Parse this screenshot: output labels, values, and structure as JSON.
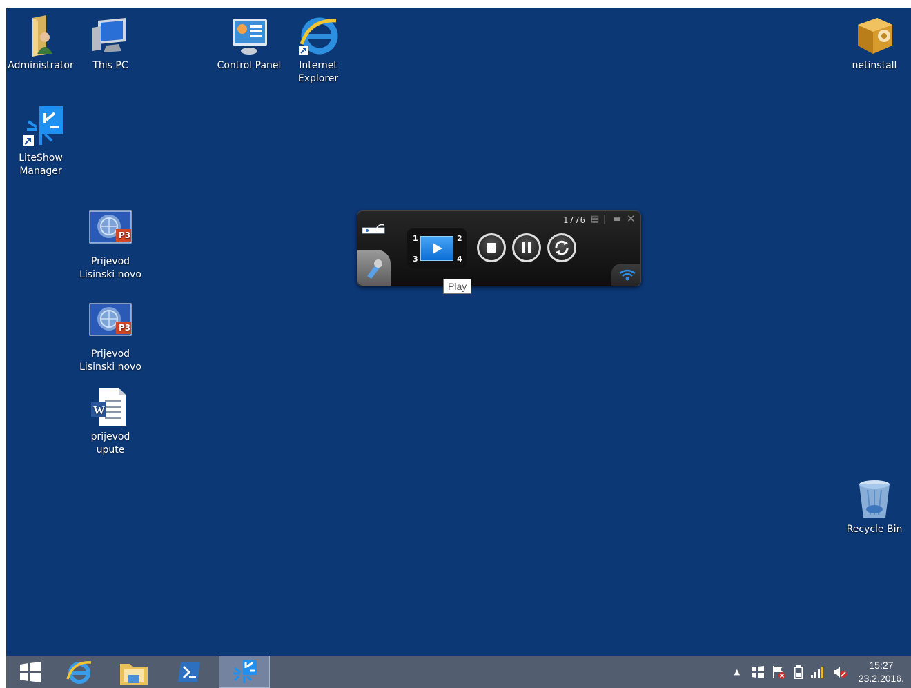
{
  "desktop": {
    "background_color": "#0c3876",
    "icons": [
      {
        "label": "Administrator",
        "icon": "user-folder-icon"
      },
      {
        "label": "This PC",
        "icon": "computer-icon"
      },
      {
        "label": "Control Panel",
        "icon": "control-panel-icon"
      },
      {
        "label": "Internet\nExplorer",
        "icon": "internet-explorer-icon"
      },
      {
        "label": "netinstall",
        "icon": "package-icon"
      },
      {
        "label": "LiteShow\nManager",
        "icon": "liteshow-icon"
      },
      {
        "label": "Prijevod\nLisinski novo",
        "icon": "powerpoint-file-icon"
      },
      {
        "label": "Prijevod\nLisinski novo",
        "icon": "powerpoint-file-icon"
      },
      {
        "label": "prijevod\nupute",
        "icon": "word-document-icon"
      },
      {
        "label": "Recycle Bin",
        "icon": "recycle-bin-icon"
      }
    ]
  },
  "liteshow": {
    "counter": "1776",
    "grid_numbers": [
      "1",
      "2",
      "3",
      "4"
    ],
    "tooltip": "Play",
    "buttons": [
      "play-icon",
      "stop-icon",
      "pause-icon",
      "refresh-icon"
    ]
  },
  "taskbar": {
    "items": [
      "start-icon",
      "internet-explorer-icon",
      "file-explorer-icon",
      "powershell-icon",
      "liteshow-icon"
    ],
    "active_item": "liteshow-icon",
    "tray": [
      "show-hidden-icons",
      "network-display-icon",
      "action-center-icon",
      "battery-icon",
      "signal-icon",
      "volume-muted-icon"
    ],
    "clock": {
      "time": "15:27",
      "date": "23.2.2016."
    }
  }
}
